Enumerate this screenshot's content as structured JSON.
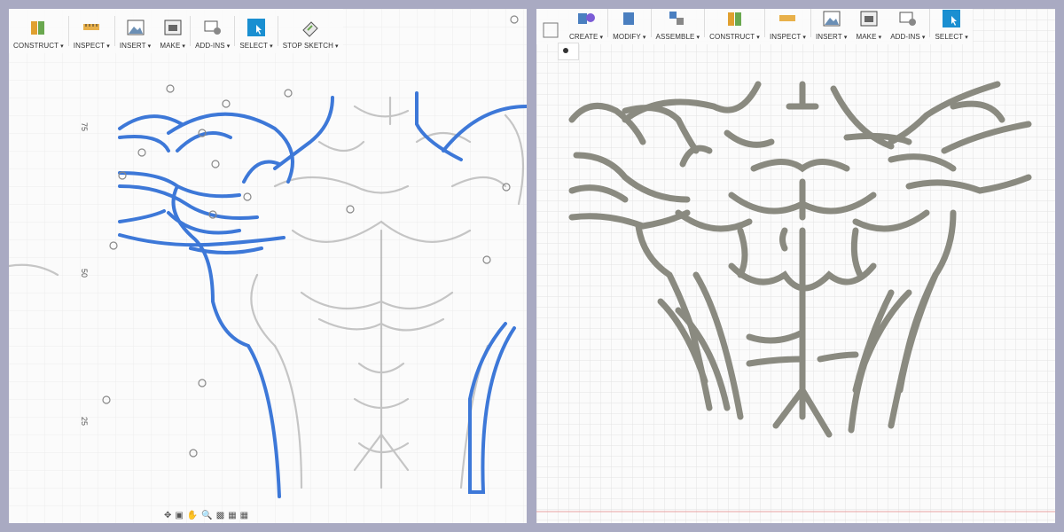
{
  "left_window": {
    "toolbar": [
      {
        "id": "construct",
        "label": "CONSTRUCT"
      },
      {
        "id": "inspect",
        "label": "INSPECT"
      },
      {
        "id": "insert",
        "label": "INSERT"
      },
      {
        "id": "make",
        "label": "MAKE"
      },
      {
        "id": "add_ins",
        "label": "ADD-INS"
      },
      {
        "id": "select",
        "label": "SELECT"
      },
      {
        "id": "stop_sketch",
        "label": "STOP SKETCH"
      }
    ],
    "ruler_labels": [
      "75",
      "50",
      "25"
    ]
  },
  "right_window": {
    "toolbar": [
      {
        "id": "create",
        "label": "CREATE"
      },
      {
        "id": "modify",
        "label": "MODIFY"
      },
      {
        "id": "assemble",
        "label": "ASSEMBLE"
      },
      {
        "id": "construct",
        "label": "CONSTRUCT"
      },
      {
        "id": "inspect",
        "label": "INSPECT"
      },
      {
        "id": "insert",
        "label": "INSERT"
      },
      {
        "id": "make",
        "label": "MAKE"
      },
      {
        "id": "add_ins",
        "label": "ADD-INS"
      },
      {
        "id": "select",
        "label": "SELECT"
      }
    ]
  },
  "colors": {
    "sketch_blue": "#3d78d8",
    "extrude_gray": "#8a8a80",
    "grid": "#e3e3e3",
    "select_blue": "#1a8fd1"
  },
  "icons": [
    "construct-icon",
    "inspect-icon",
    "insert-icon",
    "make-icon",
    "add-ins-icon",
    "select-icon",
    "stop-sketch-icon",
    "create-icon",
    "modify-icon",
    "assemble-icon"
  ]
}
